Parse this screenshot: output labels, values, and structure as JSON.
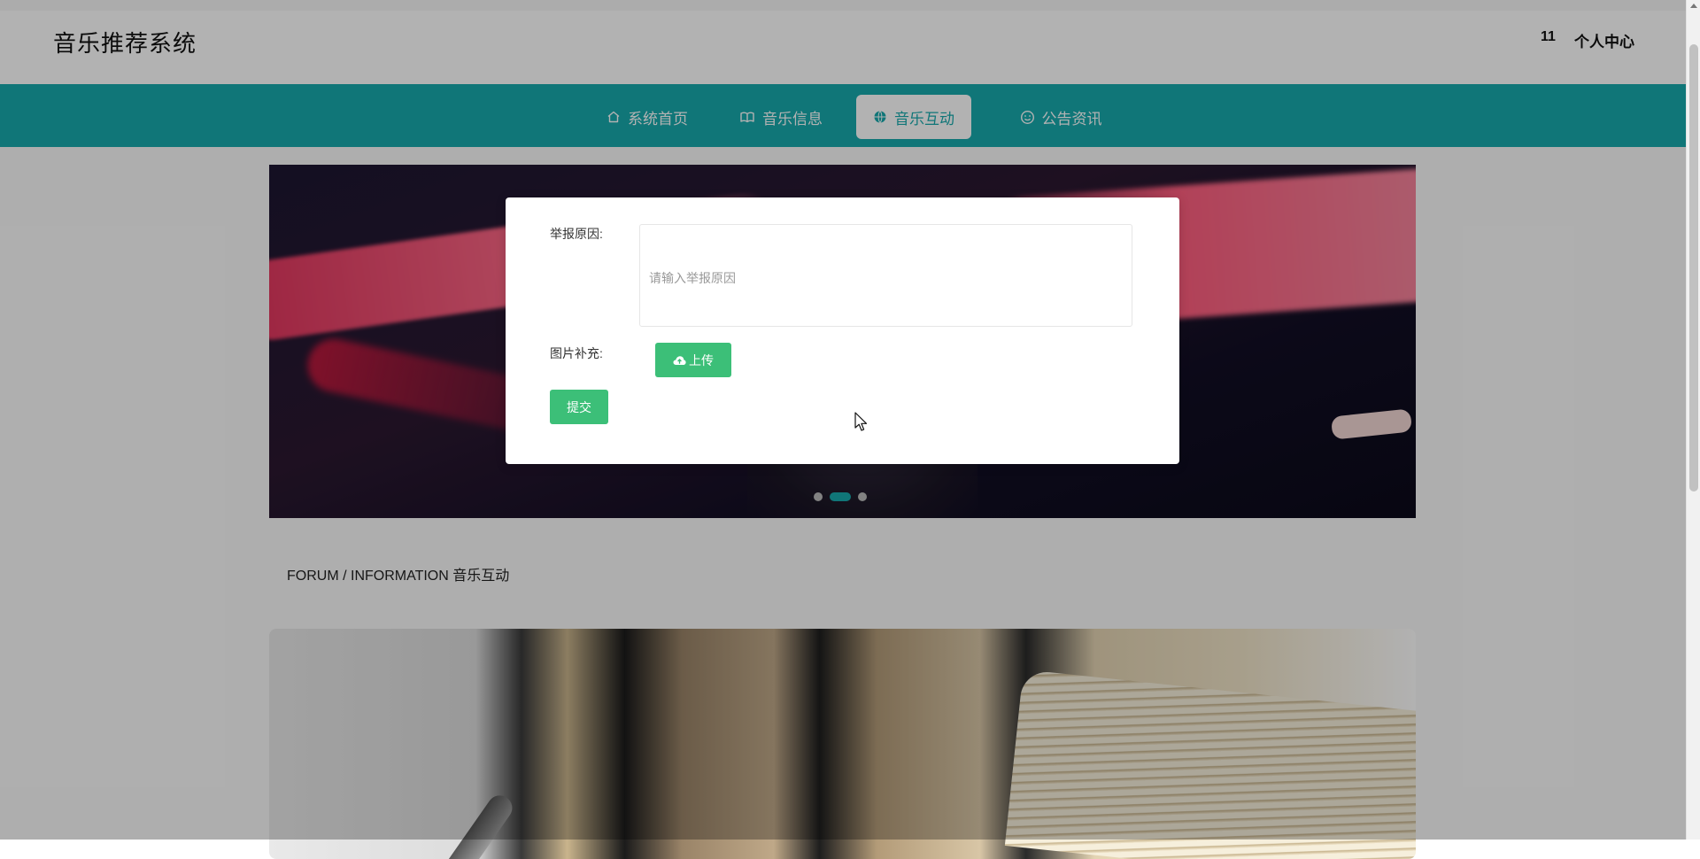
{
  "header": {
    "app_title": "音乐推荐系统",
    "user_id": "11",
    "user_center": "个人中心"
  },
  "nav": {
    "items": [
      {
        "label": "系统首页",
        "icon": "home-icon",
        "active": false
      },
      {
        "label": "音乐信息",
        "icon": "book-icon",
        "active": false
      },
      {
        "label": "音乐互动",
        "icon": "globe-icon",
        "active": true
      },
      {
        "label": "公告资讯",
        "icon": "smile-icon",
        "active": false
      }
    ]
  },
  "content": {
    "section_title": "FORUM / INFORMATION 音乐互动",
    "carousel_active_index": 1,
    "carousel_count": 3
  },
  "modal": {
    "reason_label": "举报原因:",
    "reason_placeholder": "请输入举报原因",
    "reason_value": "",
    "image_label": "图片补充:",
    "upload_label": "上传",
    "submit_label": "提交"
  },
  "colors": {
    "brand": "#17a9ad",
    "button": "#3cbf78",
    "overlay": "rgba(0,0,0,0.30)"
  }
}
